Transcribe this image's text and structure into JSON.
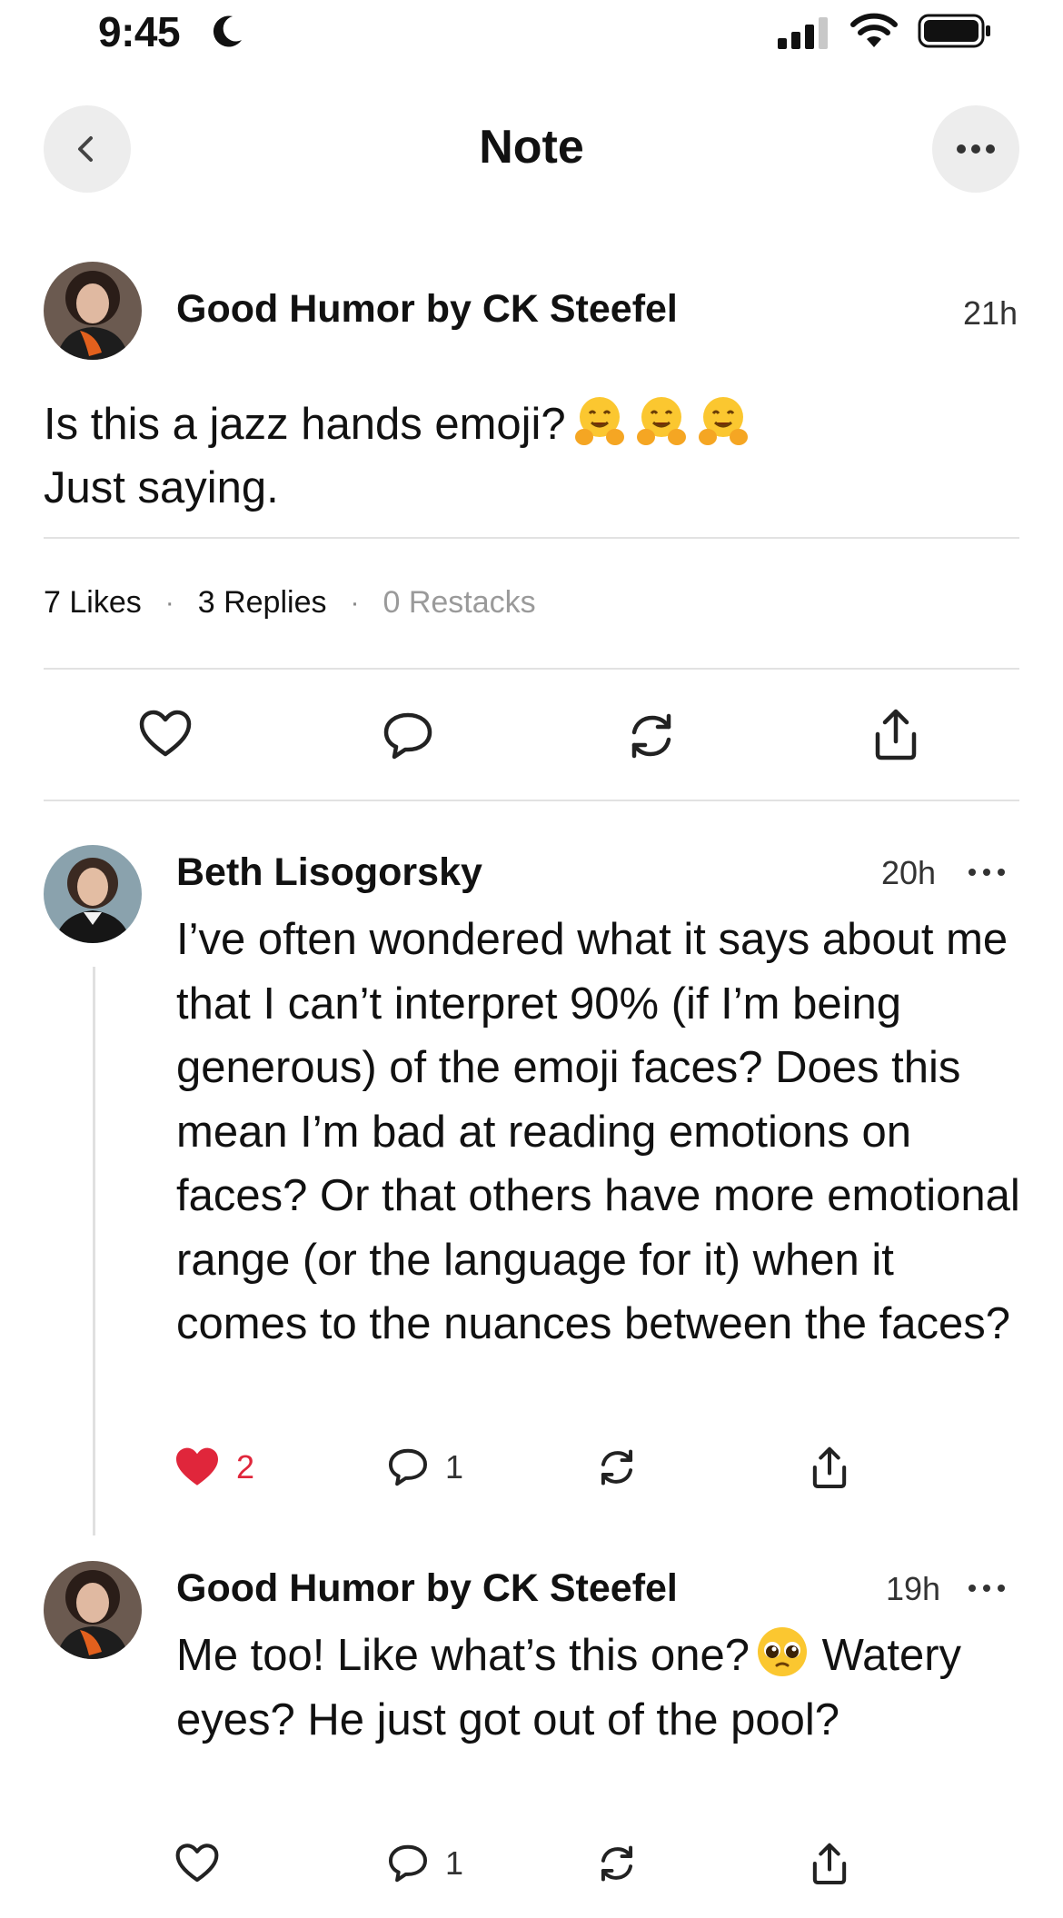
{
  "status_bar": {
    "time": "9:45"
  },
  "header": {
    "title": "Note"
  },
  "note": {
    "author": "Good Humor by CK Steefel",
    "time": "21h",
    "line1": "Is this a jazz hands emoji?",
    "line2": "Just saying.",
    "stats": {
      "likes": "7 Likes",
      "replies": "3 Replies",
      "restacks": "0 Restacks"
    }
  },
  "replies": [
    {
      "author": "Beth Lisogorsky",
      "time": "20h",
      "text": "I’ve often wondered what it says about me that I can’t interpret 90% (if I’m being generous) of the emoji faces? Does this mean I’m bad at reading emotions on faces? Or that others have more emotional range (or the language for it) when it comes to the nuances between the faces?",
      "likes": "2",
      "comments": "1"
    },
    {
      "author": "Good Humor by CK Steefel",
      "time": "19h",
      "line1": "Me too! Like what’s this one?",
      "line2": "Watery eyes? He just got out of the pool?",
      "comments": "1"
    }
  ],
  "colors": {
    "accent_like": "#e0263b",
    "divider": "#e2e2e2",
    "button_bg": "#ededed"
  }
}
